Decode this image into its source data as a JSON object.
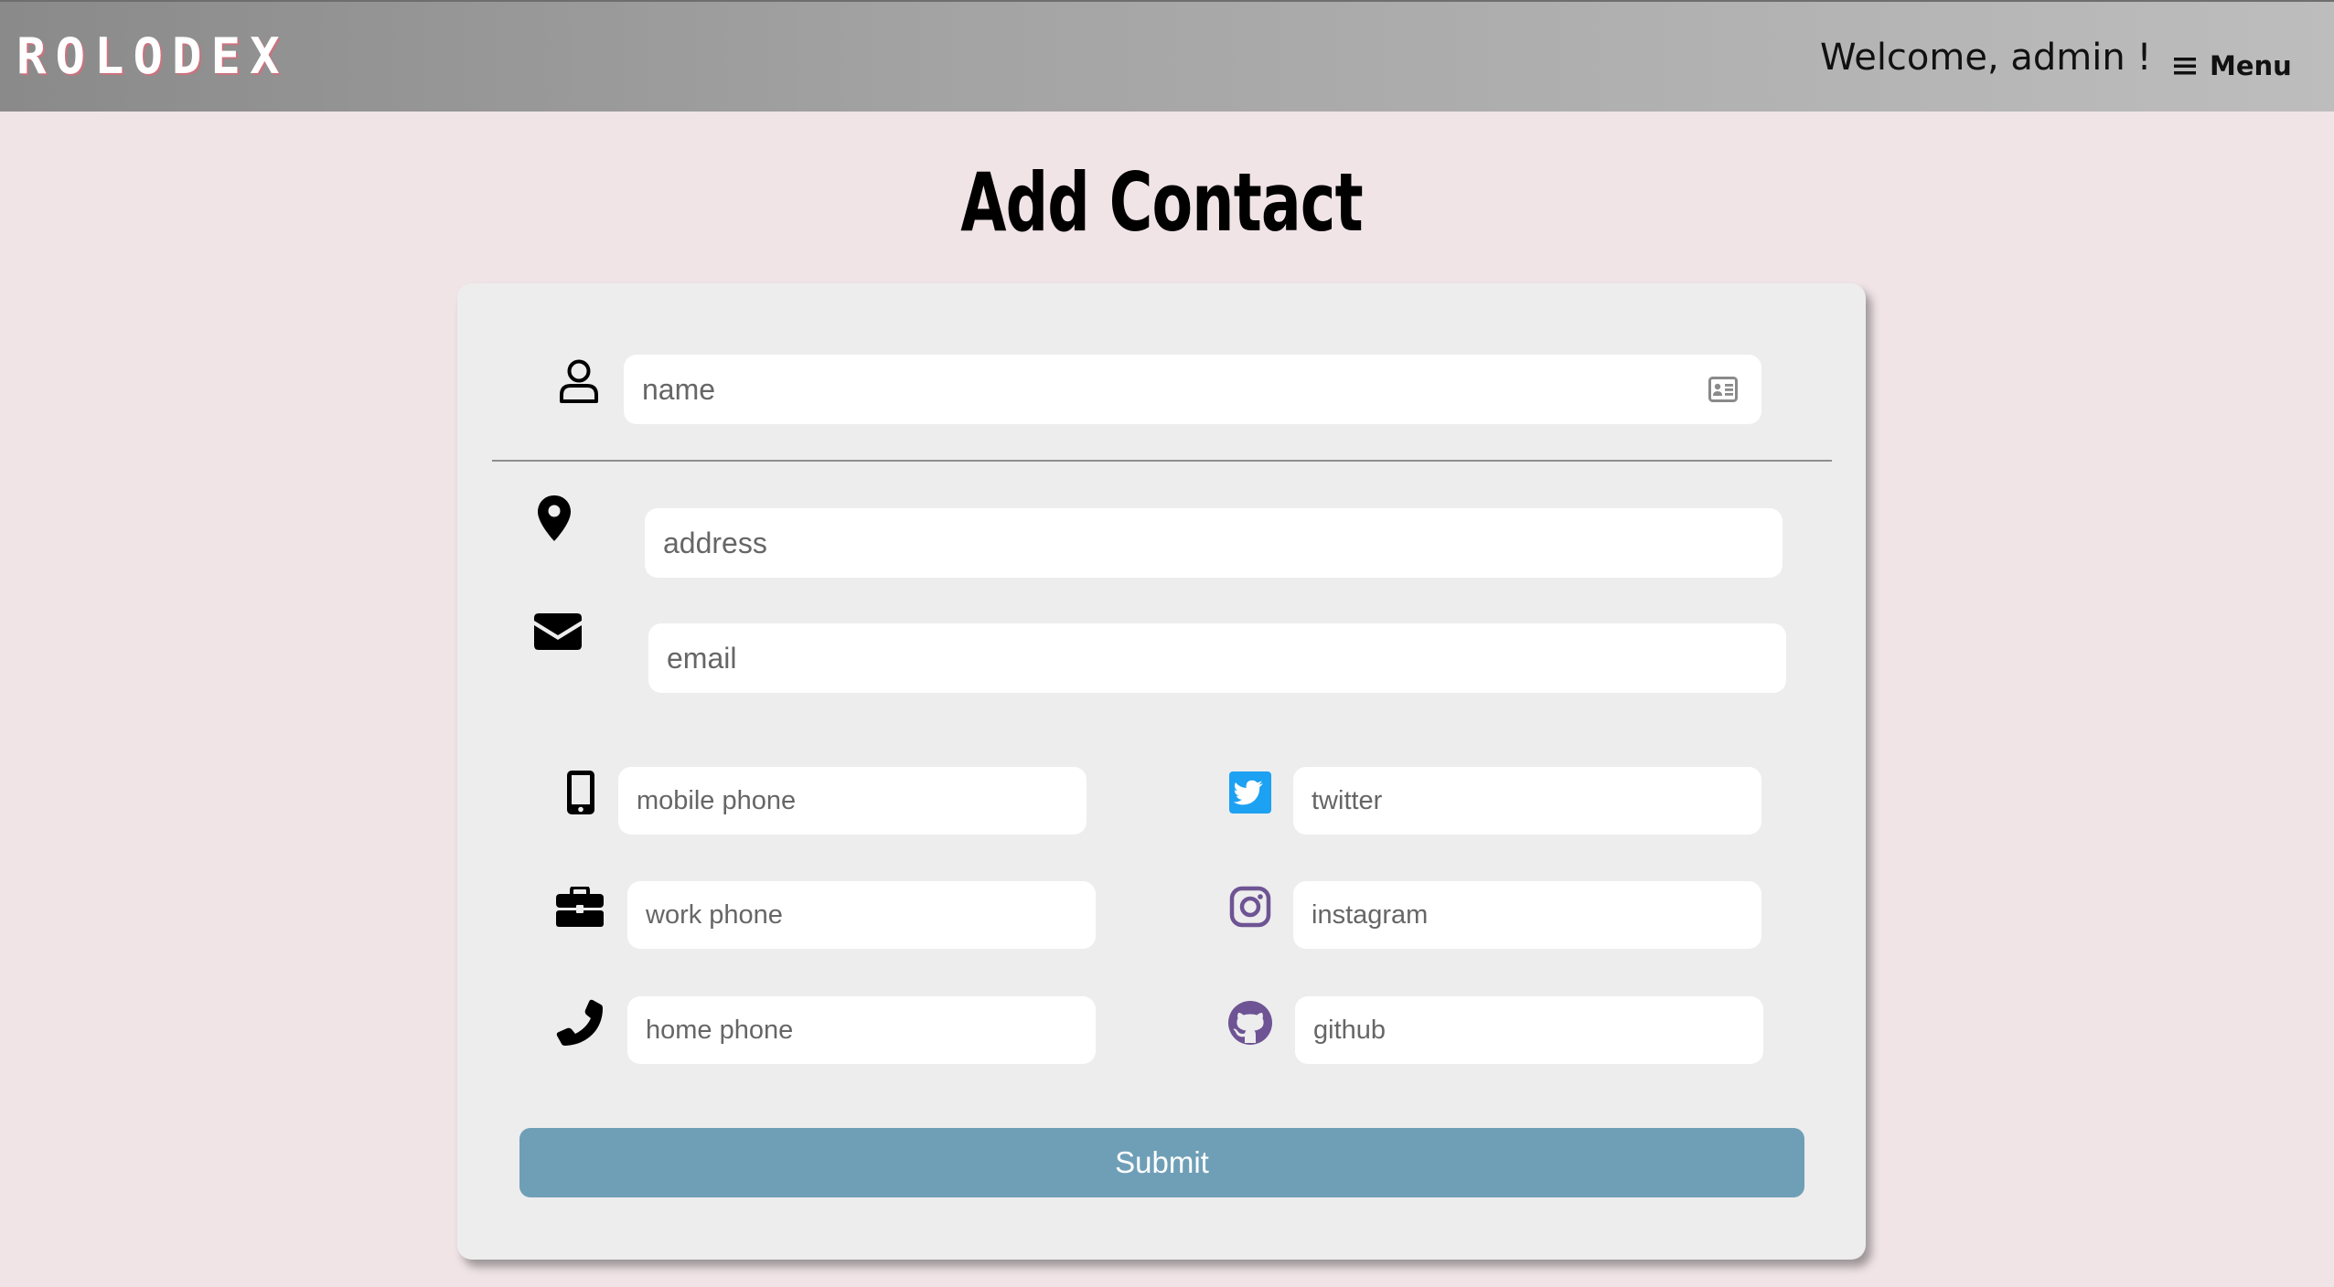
{
  "header": {
    "logo": "ROLODEX",
    "welcome": "Welcome, admin !",
    "menu_label": "Menu"
  },
  "page": {
    "title": "Add Contact"
  },
  "form": {
    "name_placeholder": "name",
    "address_placeholder": "address",
    "email_placeholder": "email",
    "mobile_phone_placeholder": "mobile phone",
    "work_phone_placeholder": "work phone",
    "home_phone_placeholder": "home phone",
    "twitter_placeholder": "twitter",
    "instagram_placeholder": "instagram",
    "github_placeholder": "github",
    "submit_label": "Submit"
  },
  "icons": {
    "name": "user-icon",
    "name_field": "id-card-icon",
    "address": "map-pin-icon",
    "email": "envelope-icon",
    "mobile_phone": "mobile-icon",
    "work_phone": "briefcase-icon",
    "home_phone": "phone-icon",
    "twitter": "twitter-icon",
    "instagram": "instagram-icon",
    "github": "github-icon",
    "menu": "hamburger-icon"
  },
  "colors": {
    "background": "#f0e4e7",
    "card": "#ededed",
    "submit": "#6f9fb7",
    "twitter": "#1da1f2",
    "instagram_github": "#6e5494"
  }
}
